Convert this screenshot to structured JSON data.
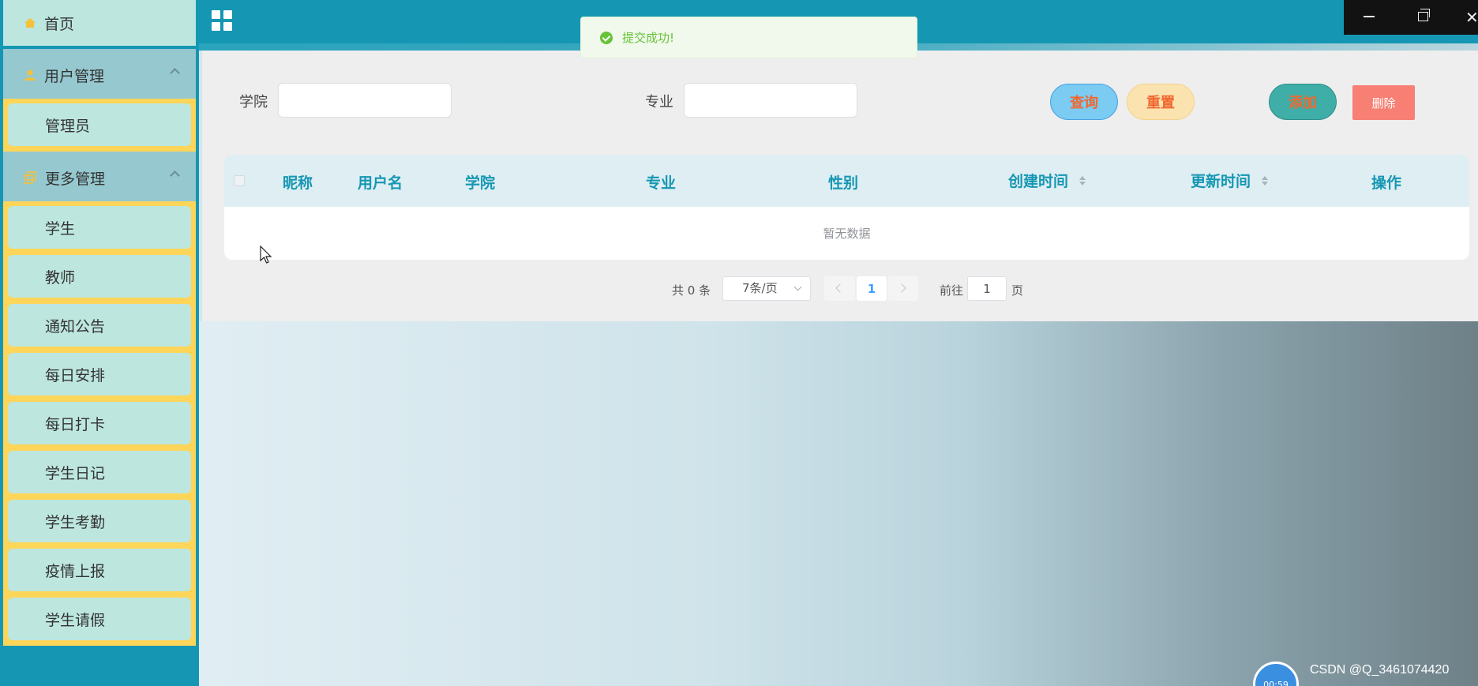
{
  "sidebar": {
    "home_label": "首页",
    "groups": [
      {
        "label": "用户管理",
        "items": [
          "管理员"
        ]
      },
      {
        "label": "更多管理",
        "items": [
          "学生",
          "教师",
          "通知公告",
          "每日安排",
          "每日打卡",
          "学生日记",
          "学生考勤",
          "疫情上报",
          "学生请假"
        ]
      }
    ]
  },
  "toast": {
    "message": "提交成功!"
  },
  "search": {
    "college_label": "学院",
    "major_label": "专业",
    "query_label": "查询",
    "reset_label": "重置",
    "add_label": "添加",
    "delete_label": "删除"
  },
  "table": {
    "headers": [
      "昵称",
      "用户名",
      "学院",
      "专业",
      "性别",
      "创建时间",
      "更新时间",
      "操作"
    ],
    "empty_text": "暂无数据"
  },
  "pagination": {
    "total_text": "共 0 条",
    "page_size": "7条/页",
    "current_page": "1",
    "goto_label": "前往",
    "goto_value": "1",
    "page_suffix": "页"
  },
  "overlay": {
    "watermark": "CSDN @Q_3461074420",
    "timer": "00:59"
  },
  "colors": {
    "accent": "#1597b3",
    "sidebar_item": "#bde6df",
    "sidebar_highlight": "#fdd558",
    "success": "#67c23a"
  }
}
